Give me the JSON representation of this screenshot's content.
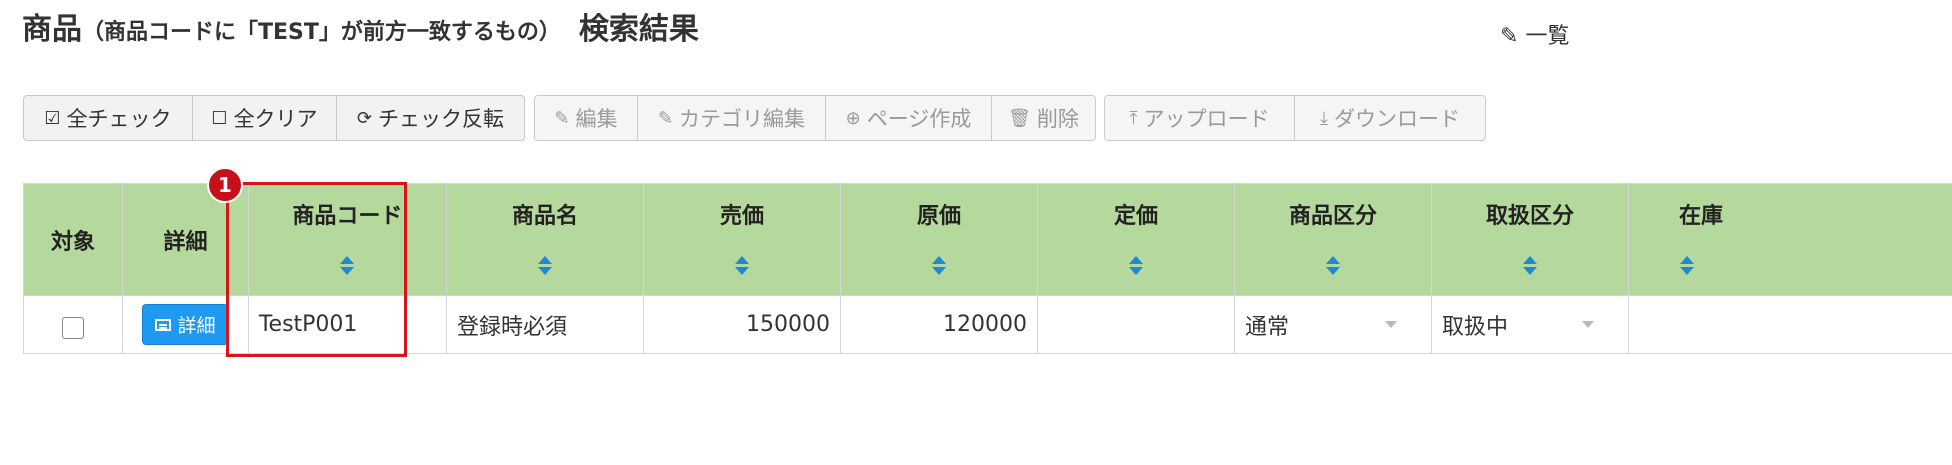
{
  "header": {
    "title_main": "商品",
    "title_sub": "（商品コードに「TEST」が前方一致するもの）",
    "title_result": "検索結果",
    "top_right_label": "一覧",
    "top_right_icon": "pencil-icon"
  },
  "toolbar": {
    "group1": [
      {
        "icon": "check-square-icon",
        "glyph": "☑",
        "label": "全チェック"
      },
      {
        "icon": "square-icon",
        "glyph": "☐",
        "label": "全クリア"
      },
      {
        "icon": "refresh-icon",
        "glyph": "⟳",
        "label": "チェック反転"
      }
    ],
    "group2": [
      {
        "icon": "pencil-icon",
        "glyph": "✎",
        "label": "編集"
      },
      {
        "icon": "pencil-icon",
        "glyph": "✎",
        "label": "カテゴリ編集"
      },
      {
        "icon": "plus-circle-icon",
        "glyph": "⊕",
        "label": "ページ作成"
      },
      {
        "icon": "trash-icon",
        "glyph": "🗑",
        "label": "削除"
      }
    ],
    "group3": [
      {
        "icon": "upload-icon",
        "glyph": "⤒",
        "label": "アップロード"
      },
      {
        "icon": "download-icon",
        "glyph": "⤓",
        "label": "ダウンロード"
      }
    ]
  },
  "table": {
    "headers": [
      "対象",
      "詳細",
      "商品コード",
      "商品名",
      "売価",
      "原価",
      "定価",
      "商品区分",
      "取扱区分",
      "在庫"
    ],
    "row": {
      "detail_label": "詳細",
      "code": "TestP001",
      "name": "登録時必須",
      "price": "150000",
      "cost": "120000",
      "list_price": "",
      "category": "通常",
      "handling": "取扱中",
      "stock": ""
    }
  },
  "annotation": {
    "marker_number": "1",
    "marker_color": "#c8101b"
  }
}
